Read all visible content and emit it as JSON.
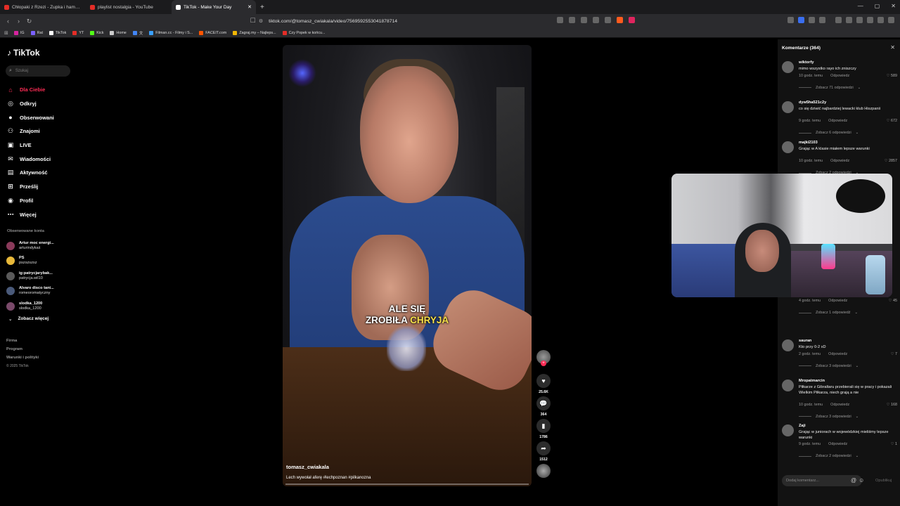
{
  "browser": {
    "tabs": [
      {
        "title": "Chłopaki z Rzezi - Zupka i hamburg...",
        "color": "#e52d27"
      },
      {
        "title": "playlist nostalgia - YouTube",
        "color": "#e52d27"
      },
      {
        "title": "TikTok - Make Your Day",
        "color": "#ffffff"
      }
    ],
    "url": "tiktok.com/@tomasz_cwiakala/video/7569592553041878714",
    "bookmarks": [
      {
        "label": "IG",
        "color": "#d6249f"
      },
      {
        "label": "Rat",
        "color": "#7b61ff"
      },
      {
        "label": "TikTok",
        "color": "#ffffff"
      },
      {
        "label": "YT",
        "color": "#e52d27"
      },
      {
        "label": "Kick",
        "color": "#53fc18"
      },
      {
        "label": "Home",
        "color": "#cccccc"
      },
      {
        "label": "文",
        "color": "#4285f4"
      },
      {
        "label": "Filman.cc - Filmy i S...",
        "color": "#3aa0ff"
      },
      {
        "label": "FACEIT.com",
        "color": "#ff5500"
      },
      {
        "label": "Zagraj.my – Najleps...",
        "color": "#f2b705"
      },
      {
        "label": "Czy Popek w końcu...",
        "color": "#e52d27"
      }
    ]
  },
  "sidebar": {
    "logo": "TikTok",
    "search_placeholder": "Szukaj",
    "nav": [
      {
        "label": "Dla Ciebie",
        "icon": "home-icon",
        "glyph": "⌂",
        "active": true
      },
      {
        "label": "Odkryj",
        "icon": "compass-icon",
        "glyph": "◎",
        "active": false
      },
      {
        "label": "Obserwowani",
        "icon": "following-icon",
        "glyph": "●",
        "active": false
      },
      {
        "label": "Znajomi",
        "icon": "friends-icon",
        "glyph": "⚇",
        "active": false
      },
      {
        "label": "LIVE",
        "icon": "live-icon",
        "glyph": "▣",
        "active": false
      },
      {
        "label": "Wiadomości",
        "icon": "messages-icon",
        "glyph": "✉",
        "active": false
      },
      {
        "label": "Aktywność",
        "icon": "activity-icon",
        "glyph": "▤",
        "active": false
      },
      {
        "label": "Prześlij",
        "icon": "upload-icon",
        "glyph": "⊞",
        "active": false
      },
      {
        "label": "Profil",
        "icon": "profile-icon",
        "glyph": "◉",
        "active": false
      },
      {
        "label": "Więcej",
        "icon": "more-icon",
        "glyph": "⋯",
        "active": false
      }
    ],
    "followed_title": "Obserwowane konta",
    "followed": [
      {
        "name": "Artur moc energi...",
        "handle": "arturindykaś"
      },
      {
        "name": "PS",
        "handle": "pszszszsz"
      },
      {
        "name": "ig:patrycjarybak...",
        "handle": "patrycja.wil10"
      },
      {
        "name": "Alvaro disco tani...",
        "handle": "romeoromatyczny"
      },
      {
        "name": "slodka_1200",
        "handle": "slodka_1200"
      }
    ],
    "see_more": "Zobacz więcej",
    "footer": [
      "Firma",
      "Program",
      "Warunki i polityki"
    ],
    "copyright": "© 2025 TikTok"
  },
  "video": {
    "caption_line1": "ALE SIĘ",
    "caption_line2a": "ZROBIŁA",
    "caption_line2b": "CHRYJA",
    "author": "tomasz_cwiakala",
    "description": "Lech wywołał aferę #lechpoznan #pilkanozna",
    "likes": "25.6K",
    "comments": "364",
    "saves": "1786",
    "shares": "1512"
  },
  "comments": {
    "title": "Komentarze (364)",
    "input_placeholder": "Dodaj komentarz...",
    "post_label": "Opublikuj",
    "reply_label": "Odpowiedz",
    "items": [
      {
        "user": "wiktorfy",
        "text": "mimo wszystko rayo ich zniszczy",
        "time": "10 godz. temu",
        "likes": "589",
        "replies": "Zobacz 71 odpowiedzi"
      },
      {
        "user": "dyw5ha521c2y",
        "text": "co się dziwić najbardziej lewacki klub Hiszpanii",
        "time": "9 godz. temu",
        "likes": "672",
        "replies": "Zobacz 6 odpowiedzi"
      },
      {
        "user": "majki2103",
        "text": "Grając w A klasie miałem lepsze warunki",
        "time": "10 godz. temu",
        "likes": "2857",
        "replies": "Zobacz 2 odpowiedzi"
      },
      {
        "user": "",
        "text": "",
        "time": "4 godz. temu",
        "likes": "45",
        "replies": "Zobacz 1 odpowiedź"
      },
      {
        "user": "sauran",
        "text": "Kto przy 0-2 xD",
        "time": "2 godz. temu",
        "likes": "7",
        "replies": "Zobacz 3 odpowiedzi"
      },
      {
        "user": "Mropatmarcin",
        "text": "Piłkarze z Gibraltaru przebierali się w pracy i pokazali Wielkim Piłkarza, niech grają a nie",
        "time": "10 godz. temu",
        "likes": "168",
        "replies": "Zobacz 3 odpowiedzi"
      },
      {
        "user": "Zaji",
        "text": "Grając w juniorach w wojewódzkiej mieliśmy lepsze warunki",
        "time": "9 godz. temu",
        "likes": "1",
        "replies": "Zobacz 2 odpowiedzi"
      }
    ]
  }
}
